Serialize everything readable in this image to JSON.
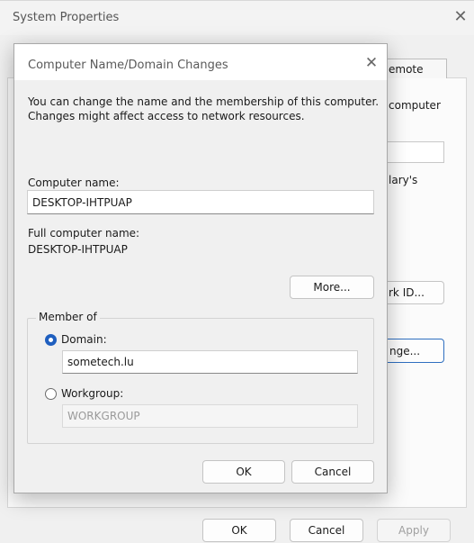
{
  "system_properties": {
    "title": "System Properties",
    "close_glyph": "✕",
    "tab_remote_fragment": "emote",
    "text_computer_fragment": "computer",
    "text_ary_fragment": "lary's",
    "network_id_fragment": "rk ID...",
    "change_fragment": "nge...",
    "ok_label": "OK",
    "cancel_label": "Cancel",
    "apply_label": "Apply"
  },
  "dialog": {
    "title": "Computer Name/Domain Changes",
    "close_glyph": "✕",
    "description": "You can change the name and the membership of this computer. Changes might affect access to network resources.",
    "computer_name_label": "Computer name:",
    "computer_name_value": "DESKTOP-IHTPUAP",
    "full_name_label": "Full computer name:",
    "full_name_value": "DESKTOP-IHTPUAP",
    "more_label": "More...",
    "member_of_label": "Member of",
    "domain_label": "Domain:",
    "domain_value": "sometech.lu",
    "workgroup_label": "Workgroup:",
    "workgroup_value": "WORKGROUP",
    "selected_membership": "domain",
    "ok_label": "OK",
    "cancel_label": "Cancel"
  },
  "colors": {
    "accent": "#1f5fbf",
    "focus_border": "#2f6fc0",
    "window_bg": "#f0f0f0"
  }
}
